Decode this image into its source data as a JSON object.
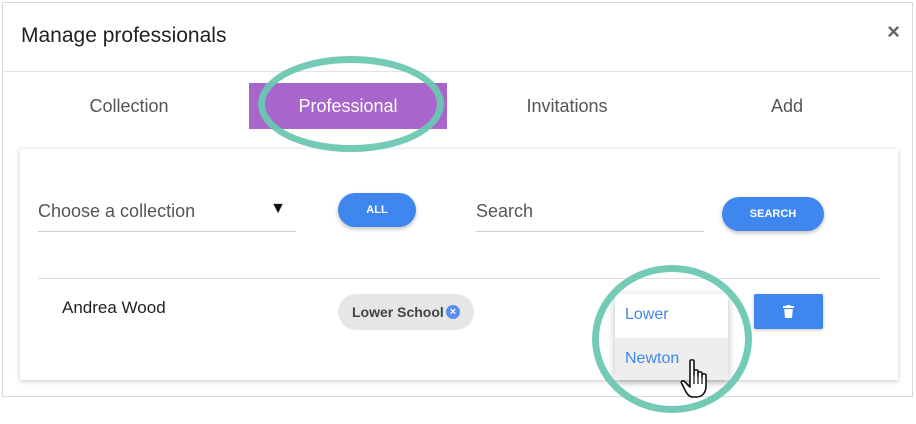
{
  "modal": {
    "title": "Manage professionals",
    "close_label": "×"
  },
  "tabs": [
    {
      "label": "Collection",
      "active": false
    },
    {
      "label": "Professional",
      "active": true
    },
    {
      "label": "Invitations",
      "active": false
    },
    {
      "label": "Add",
      "active": false
    }
  ],
  "filters": {
    "collection_select": {
      "value": "Choose a collection",
      "caret": "▼"
    },
    "all_button": "ALL",
    "search_placeholder": "Search",
    "search_button": "SEARCH"
  },
  "rows": [
    {
      "name": "Andrea Wood",
      "tag": "Lower School",
      "tag_remove": "×",
      "dropdown_options": [
        {
          "label": "Lower",
          "hovered": false
        },
        {
          "label": "Newton",
          "hovered": true
        }
      ],
      "delete_icon": "trash-icon"
    }
  ],
  "colors": {
    "accent_blue": "#3f86ef",
    "active_tab_purple": "#a865cc",
    "highlight_ring_teal": "#6cc7b1"
  },
  "cursor": "hand-pointer-icon"
}
